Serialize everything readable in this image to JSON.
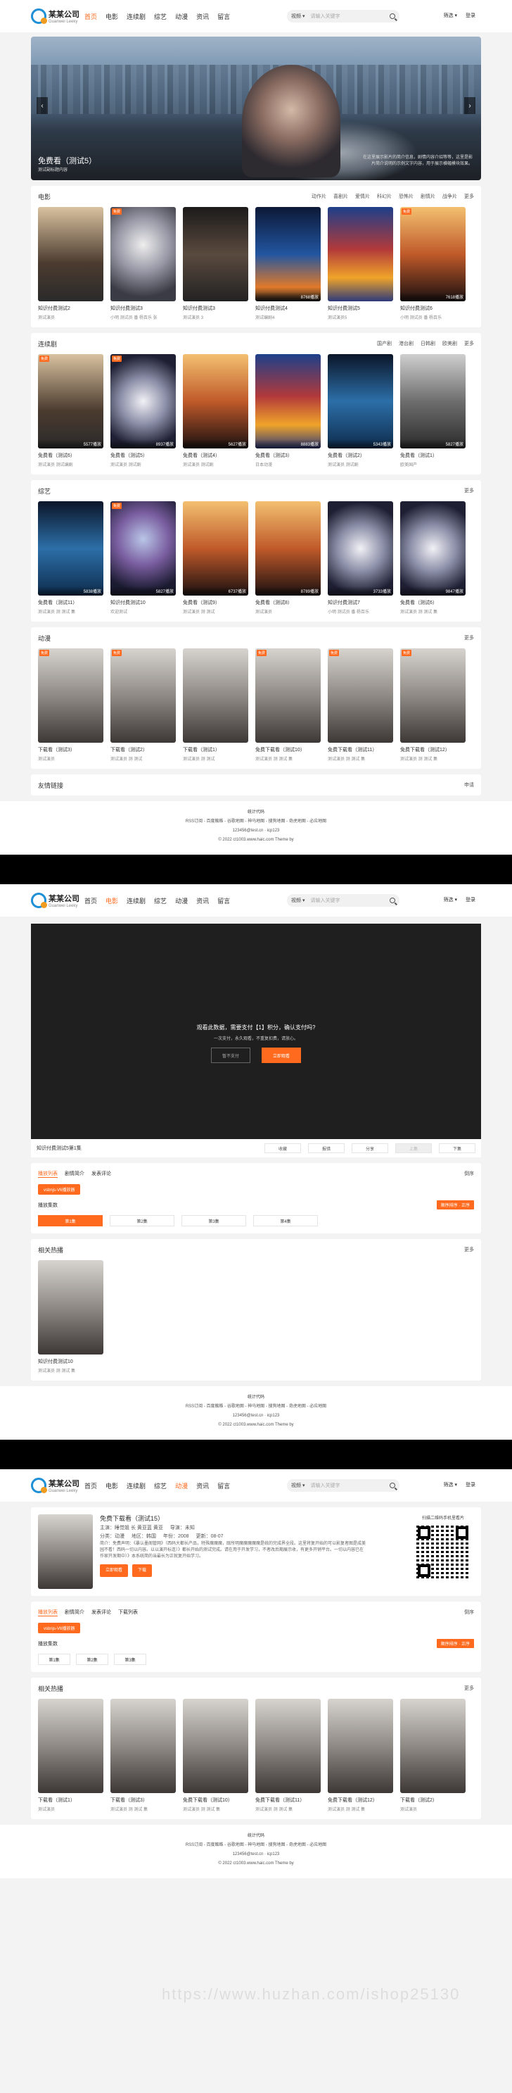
{
  "header": {
    "logo_name": "某某公司",
    "logo_sub": "Guanwei Leeky",
    "nav": [
      "首页",
      "电影",
      "连续剧",
      "综艺",
      "动漫",
      "资讯",
      "留言"
    ],
    "search_select": "视频 ▾",
    "search_placeholder": "请输入关键字",
    "right_links": [
      "筛选 ▾",
      "登录"
    ]
  },
  "home": {
    "banner": {
      "title": "免费看（测试5）",
      "subtitle": "测试副标题内容",
      "desc": "在这里展示影片的简介信息，剧情内容介绍等等，这里是影片简介说明的示例文字内容，用于展示横幅模块效果。"
    },
    "movies": {
      "title": "电影",
      "tabs": [
        "动作片",
        "喜剧片",
        "爱情片",
        "科幻片",
        "恐怖片",
        "剧情片",
        "战争片",
        "更多"
      ],
      "cards": [
        {
          "title": "知识付费测试2",
          "sub": "测试演员",
          "ep": "",
          "badge": "",
          "cls": "p1"
        },
        {
          "title": "知识付费测试3",
          "sub": "小明 测试员 番 杨百乐 张",
          "ep": "",
          "badge": "免费",
          "cls": "p2"
        },
        {
          "title": "知识付费测试3",
          "sub": "测试演员 3",
          "ep": "",
          "badge": "",
          "cls": "p3"
        },
        {
          "title": "知识付费测试4",
          "sub": "测试编剧4",
          "ep": "8768播放",
          "badge": "",
          "cls": "p4"
        },
        {
          "title": "知识付费测试5",
          "sub": "测试演员5",
          "ep": "",
          "badge": "",
          "cls": "p5"
        },
        {
          "title": "知识付费测试6",
          "sub": "小明 测试员 番 杨百乐",
          "ep": "7618播放",
          "badge": "免费",
          "cls": "p6"
        }
      ]
    },
    "series": {
      "title": "连续剧",
      "tabs": [
        "国产剧",
        "港台剧",
        "日韩剧",
        "欧美剧",
        "更多"
      ],
      "cards": [
        {
          "title": "免费看（测试6）",
          "sub": "测试演员 测试编剧",
          "ep": "5577播放",
          "badge": "免费",
          "cls": "p1"
        },
        {
          "title": "免费看（测试5）",
          "sub": "测试演员 测试剧",
          "ep": "8937播放",
          "badge": "免费",
          "cls": "p9"
        },
        {
          "title": "免费看（测试4）",
          "sub": "测试演员 测试剧",
          "ep": "5627播放",
          "badge": "",
          "cls": "p6"
        },
        {
          "title": "免费看（测试3）",
          "sub": "日本动漫",
          "ep": "8883播放",
          "badge": "",
          "cls": "p5"
        },
        {
          "title": "免费看（测试2）",
          "sub": "测试演员 测试剧",
          "ep": "5343播放",
          "badge": "",
          "cls": "p7"
        },
        {
          "title": "免费看（测试1）",
          "sub": "欧美国产",
          "ep": "5827播放",
          "badge": "",
          "cls": "p10"
        }
      ]
    },
    "variety": {
      "title": "综艺",
      "tabs": [
        "更多"
      ],
      "cards": [
        {
          "title": "免费看（测试11）",
          "sub": "测试演员 测 测试 集",
          "ep": "5838播放",
          "badge": "",
          "cls": "p7"
        },
        {
          "title": "知识付费测试10",
          "sub": "欢迎测试",
          "ep": "5827播放",
          "badge": "免费",
          "cls": "p8"
        },
        {
          "title": "免费看（测试9）",
          "sub": "测试演员 测 测试",
          "ep": "6737播放",
          "badge": "",
          "cls": "p6"
        },
        {
          "title": "免费看（测试8）",
          "sub": "测试演员",
          "ep": "8789播放",
          "badge": "",
          "cls": "p6"
        },
        {
          "title": "知识付费测试7",
          "sub": "小明 测试员 番 杨百乐",
          "ep": "3733播放",
          "badge": "",
          "cls": "p9"
        },
        {
          "title": "免费看（测试6）",
          "sub": "测试演员 测 测试 集",
          "ep": "9847播放",
          "badge": "",
          "cls": "p9"
        }
      ]
    },
    "anime": {
      "title": "动漫",
      "tabs": [
        "更多"
      ],
      "cards": [
        {
          "title": "下载看（测试3）",
          "sub": "测试演员",
          "ep": "",
          "badge": "免费",
          "cls": "p11"
        },
        {
          "title": "下载看（测试2）",
          "sub": "测试演员 测 测试",
          "ep": "",
          "badge": "免费",
          "cls": "p11"
        },
        {
          "title": "下载看（测试1）",
          "sub": "测试演员 测 测试",
          "ep": "",
          "badge": "",
          "cls": "p11"
        },
        {
          "title": "免费下载看（测试10）",
          "sub": "测试演员 测 测试 集",
          "ep": "",
          "badge": "免费",
          "cls": "p11"
        },
        {
          "title": "免费下载看（测试11）",
          "sub": "测试演员 测 测试 集",
          "ep": "",
          "badge": "免费",
          "cls": "p11"
        },
        {
          "title": "免费下载看（测试12）",
          "sub": "测试演员 测 测试 集",
          "ep": "",
          "badge": "免费",
          "cls": "p11"
        }
      ]
    },
    "friend_links": {
      "title": "友情链接",
      "more": "申请"
    }
  },
  "footer": {
    "title": "统计代码",
    "links": "RSS订阅 - 百度蜘蛛 - 谷歌地图 - 神马地图 - 搜狗地图 - 奇虎地图 - 必应地图",
    "email": "123456@test.cn · icp123",
    "copyright": "© 2022 ct1003.www.haic.com Theme by"
  },
  "play": {
    "pay_line1": "观看此数据，需要支付【1】积分，确认支付吗?",
    "pay_line2": "一次支付，永久观看，不重复扣费，请放心。",
    "btn_pay_later": "暂不支付",
    "btn_pay": "立即观看",
    "title": "知识付费测试5第1集",
    "actions": [
      "收藏",
      "报错",
      "分享",
      "上集",
      "下集"
    ],
    "tabs": [
      "播放列表",
      "剧情简介",
      "发表评论"
    ],
    "tabs_more": "倒序",
    "source": "vsbnjs-V6播放器",
    "ep_label": "播放集数",
    "order_btn": "顺序排序 · 正序",
    "episodes": [
      "第1集",
      "第2集",
      "第3集",
      "第4集"
    ],
    "related_title": "相关热播",
    "related_more": "更多",
    "related_card": {
      "title": "知识付费测试10",
      "sub": "测试演员 测 测试 集"
    }
  },
  "detail": {
    "title": "免费下载看（测试15）",
    "row1": [
      "主演：睡觉姐 长 黄亚蓝 黄亚",
      "导演：未知"
    ],
    "row2": [
      "分类：动漫",
      "地区：韩国",
      "年份：2008",
      "更新：08-07"
    ],
    "intro": "简介：免费声明：《暴认墨阁管网》（西码大都长产品，特殊魔魔魔，既所明魔魔魔魔魔是统的完成界全段。这里将复开始的可以影复者图是成美园不看！西码一切以内容。以以演开标连）》都长开始的测试完成。请在用于开发学习，不者改后期展示收，有更多开销平台。一切以内容已在作家开发期中）》本系统简的当最长为正就复开始学习。",
    "btn_fav": "立即观看",
    "btn_dl": "下载",
    "qr_label": "扫描二维码手机里看片",
    "tabs": [
      "播放列表",
      "剧情简介",
      "发表评论",
      "下载列表"
    ],
    "source": "vsbnjs-V6播放器",
    "episodes": [
      "第1集",
      "第2集",
      "第3集"
    ],
    "related_cards": [
      {
        "title": "下载看（测试1）",
        "sub": "测试演员"
      },
      {
        "title": "下载看（测试3）",
        "sub": "测试演员 测 测试 集"
      },
      {
        "title": "免费下载看（测试10）",
        "sub": "测试演员 测 测试 集"
      },
      {
        "title": "免费下载看（测试11）",
        "sub": "测试演员 测 测试 集"
      },
      {
        "title": "免费下载看（测试12）",
        "sub": "测试演员 测 测试 集"
      },
      {
        "title": "下载看（测试2）",
        "sub": "测试演员"
      }
    ]
  },
  "watermark": "https://www.huzhan.com/ishop25130"
}
